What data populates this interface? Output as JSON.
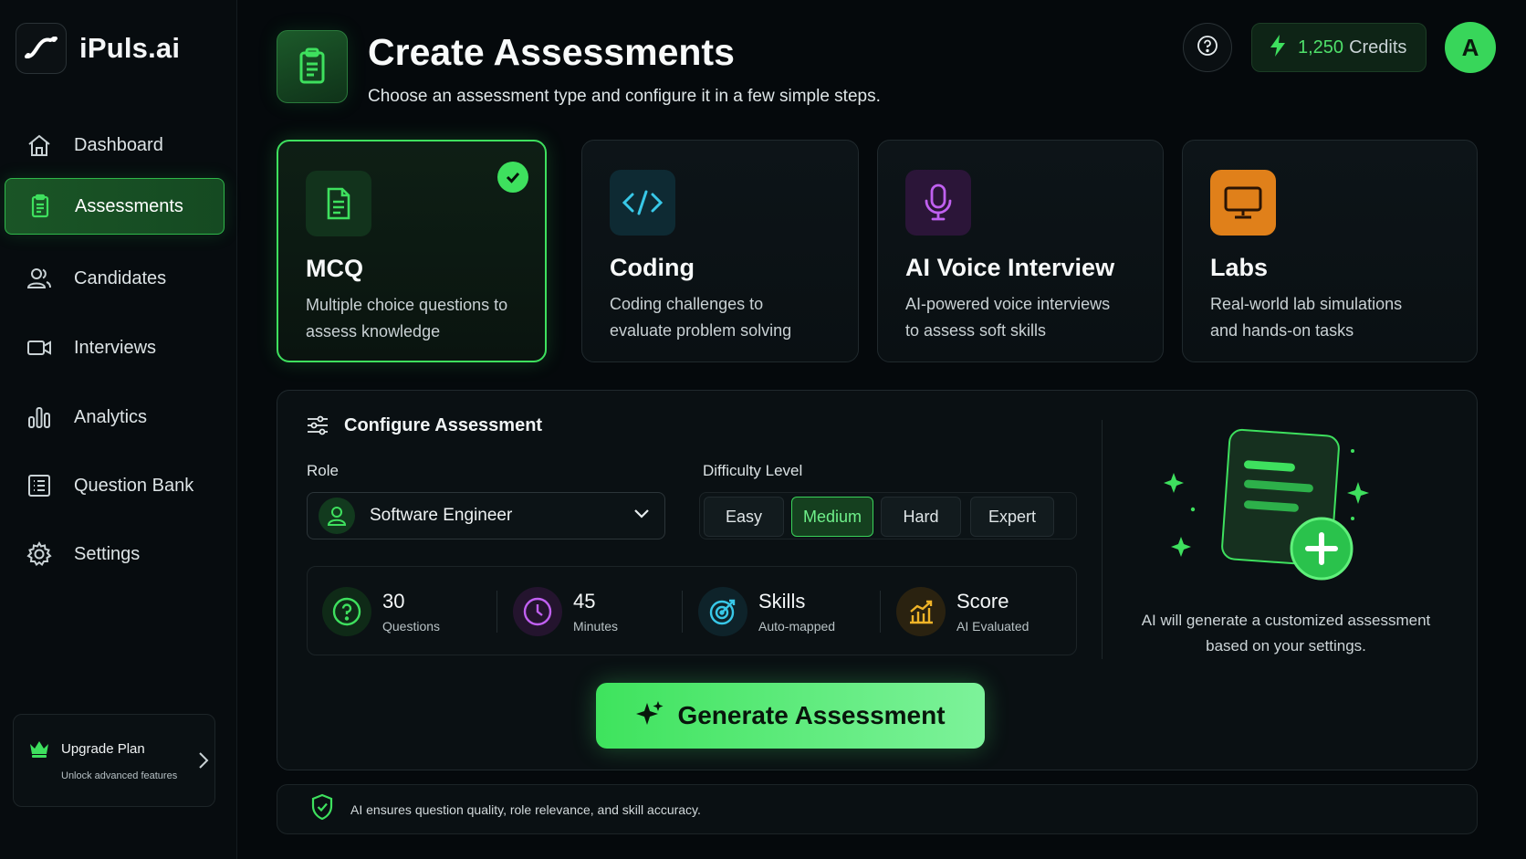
{
  "app": {
    "name": "iPuls.ai",
    "logo_icon": "pulse-logo-icon"
  },
  "sidebar": {
    "items": [
      {
        "label": "Dashboard",
        "icon": "home-icon",
        "active": false
      },
      {
        "label": "Assessments",
        "icon": "clipboard-icon",
        "active": true
      },
      {
        "label": "Candidates",
        "icon": "users-icon",
        "active": false
      },
      {
        "label": "Interviews",
        "icon": "video-icon",
        "active": false
      },
      {
        "label": "Analytics",
        "icon": "bar-chart-icon",
        "active": false
      },
      {
        "label": "Question Bank",
        "icon": "list-icon",
        "active": false
      },
      {
        "label": "Settings",
        "icon": "gear-icon",
        "active": false
      }
    ],
    "upgrade": {
      "title": "Upgrade Plan",
      "subtitle": "Unlock advanced features"
    }
  },
  "header": {
    "title": "Create Assessments",
    "subtitle": "Choose an assessment type and configure it in a few simple steps.",
    "credits_value": "1,250",
    "credits_label": "Credits",
    "avatar_initial": "A"
  },
  "assessment_types": [
    {
      "name": "MCQ",
      "description": "Multiple choice questions to assess knowledge",
      "icon": "document-icon",
      "color": "#3ee05e",
      "selected": true
    },
    {
      "name": "Coding",
      "description": "Coding challenges to evaluate problem solving",
      "icon": "code-icon",
      "color": "#38c8e8",
      "selected": false
    },
    {
      "name": "AI Voice Interview",
      "description": "AI-powered voice interviews to assess soft skills",
      "icon": "microphone-icon",
      "color": "#c060f0",
      "selected": false
    },
    {
      "name": "Labs",
      "description": "Real-world lab simulations and hands-on tasks",
      "icon": "monitor-icon",
      "color": "#f08a1c",
      "selected": false
    }
  ],
  "configure": {
    "title": "Configure Assessment",
    "role_label": "Role",
    "role_value": "Software Engineer",
    "difficulty_label": "Difficulty Level",
    "difficulty_options": [
      "Easy",
      "Medium",
      "Hard",
      "Expert"
    ],
    "difficulty_selected": "Medium",
    "stats": [
      {
        "value": "30",
        "label": "Questions",
        "icon": "question-circle-icon",
        "color": "#3ee05e"
      },
      {
        "value": "45",
        "label": "Minutes",
        "icon": "clock-icon",
        "color": "#c060f0"
      },
      {
        "value": "Skills",
        "label": "Auto-mapped",
        "icon": "target-icon",
        "color": "#38c8e8"
      },
      {
        "value": "Score",
        "label": "AI Evaluated",
        "icon": "growth-chart-icon",
        "color": "#f0b428"
      }
    ],
    "ai_note": "AI will generate a customized assessment based on your settings.",
    "generate_label": "Generate Assessment"
  },
  "footer": {
    "text": "AI ensures question quality, role relevance, and skill accuracy."
  },
  "colors": {
    "accent": "#3ee05e",
    "background": "#05090c",
    "panel": "#0a1013"
  }
}
